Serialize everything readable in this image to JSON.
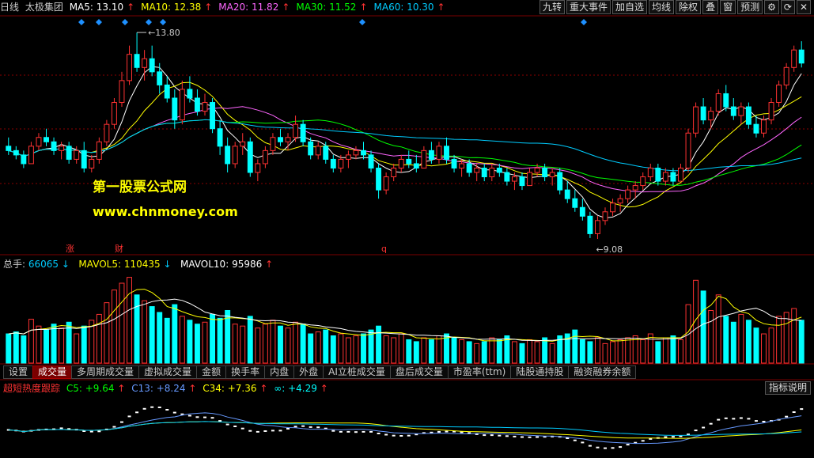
{
  "header": {
    "period": "日线",
    "stock_name": "太极集团",
    "ma": [
      {
        "label": "MA5: 13.10",
        "color": "#ffffff",
        "arrow": "up"
      },
      {
        "label": "MA10: 12.38",
        "color": "#ffff00",
        "arrow": "up"
      },
      {
        "label": "MA20: 11.82",
        "color": "#ff66ff",
        "arrow": "up"
      },
      {
        "label": "MA30: 11.52",
        "color": "#00ff00",
        "arrow": "up"
      },
      {
        "label": "MA60: 10.30",
        "color": "#00ccff",
        "arrow": "up"
      }
    ]
  },
  "toolbar": [
    "九转",
    "重大事件",
    "加自选",
    "均线",
    "除权",
    "叠",
    "窗",
    "预测"
  ],
  "price_markers": {
    "high": "13.80",
    "low": "9.08"
  },
  "watermark": {
    "line1": "第一股票公式网",
    "line2": "www.chnmoney.com"
  },
  "event_labels": [
    {
      "text": "涨"
    },
    {
      "text": "财"
    },
    {
      "text": "q"
    }
  ],
  "volume": {
    "total_label": "总手:",
    "total_value": "66065",
    "total_arrow": "down",
    "mavol5_label": "MAVOL5:",
    "mavol5_value": "110435",
    "mavol5_arrow": "down",
    "mavol10_label": "MAVOL10:",
    "mavol10_value": "95986",
    "mavol10_arrow": "up"
  },
  "tabs": [
    "设置",
    "成交量",
    "多周期成交量",
    "虚拟成交量",
    "金额",
    "换手率",
    "内盘",
    "外盘",
    "AI立桩成交量",
    "盘后成交量",
    "市盈率(ttm)",
    "陆股通持股",
    "融资融券余额"
  ],
  "active_tab": "成交量",
  "indicator": {
    "name": "超短热度跟踪",
    "c5": "C5: +9.64",
    "c13": "C13: +8.24",
    "c34": "C34: +7.36",
    "inf": "∞: +4.29",
    "help": "指标说明"
  },
  "colors": {
    "up": "#ff3232",
    "down": "#00ffff",
    "ma5": "#ffffff",
    "ma10": "#ffff00",
    "ma20": "#ff66ff",
    "ma30": "#00ff00",
    "ma60": "#00ccff",
    "grid": "#8b0000"
  },
  "chart_data": {
    "type": "candlestick",
    "price_high_label": 13.8,
    "price_low_label": 9.08,
    "candles": [
      [
        11.2,
        11.4,
        11.0,
        11.1
      ],
      [
        11.1,
        11.2,
        10.9,
        11.0
      ],
      [
        11.0,
        11.1,
        10.7,
        10.8
      ],
      [
        10.8,
        11.3,
        10.8,
        11.2
      ],
      [
        11.2,
        11.5,
        11.1,
        11.4
      ],
      [
        11.4,
        11.6,
        11.2,
        11.3
      ],
      [
        11.3,
        11.4,
        11.0,
        11.1
      ],
      [
        11.1,
        11.3,
        10.9,
        11.2
      ],
      [
        11.2,
        11.3,
        10.8,
        10.9
      ],
      [
        10.9,
        11.2,
        10.8,
        11.1
      ],
      [
        11.1,
        11.3,
        10.6,
        10.7
      ],
      [
        10.7,
        11.0,
        10.6,
        10.9
      ],
      [
        10.9,
        11.4,
        10.8,
        11.3
      ],
      [
        11.3,
        11.8,
        11.2,
        11.7
      ],
      [
        11.7,
        12.3,
        11.6,
        12.2
      ],
      [
        12.2,
        12.9,
        12.1,
        12.7
      ],
      [
        12.7,
        13.5,
        12.6,
        13.3
      ],
      [
        13.3,
        13.8,
        12.9,
        13.0
      ],
      [
        13.0,
        13.4,
        12.7,
        13.2
      ],
      [
        13.2,
        13.5,
        12.8,
        12.9
      ],
      [
        12.9,
        13.1,
        12.4,
        12.6
      ],
      [
        12.6,
        12.8,
        12.2,
        12.3
      ],
      [
        12.3,
        12.5,
        11.6,
        11.8
      ],
      [
        11.8,
        12.7,
        11.7,
        12.5
      ],
      [
        12.5,
        12.8,
        12.2,
        12.3
      ],
      [
        12.3,
        12.5,
        11.9,
        12.0
      ],
      [
        12.0,
        12.4,
        11.9,
        12.2
      ],
      [
        12.2,
        12.3,
        11.5,
        11.6
      ],
      [
        11.6,
        11.8,
        11.0,
        11.2
      ],
      [
        11.2,
        11.4,
        10.6,
        10.8
      ],
      [
        10.8,
        11.3,
        10.7,
        11.2
      ],
      [
        11.2,
        11.5,
        11.0,
        11.3
      ],
      [
        11.3,
        11.4,
        10.5,
        10.6
      ],
      [
        10.6,
        10.9,
        10.4,
        10.8
      ],
      [
        10.8,
        11.2,
        10.7,
        11.1
      ],
      [
        11.1,
        11.5,
        11.0,
        11.4
      ],
      [
        11.4,
        11.6,
        11.2,
        11.3
      ],
      [
        11.3,
        11.5,
        11.1,
        11.4
      ],
      [
        11.4,
        11.9,
        11.3,
        11.7
      ],
      [
        11.7,
        11.8,
        11.2,
        11.3
      ],
      [
        11.3,
        11.4,
        10.9,
        11.0
      ],
      [
        11.0,
        11.3,
        10.9,
        11.2
      ],
      [
        11.2,
        11.3,
        10.8,
        10.9
      ],
      [
        10.9,
        11.0,
        10.6,
        10.7
      ],
      [
        10.7,
        11.0,
        10.6,
        10.9
      ],
      [
        10.9,
        11.1,
        10.7,
        11.0
      ],
      [
        11.0,
        11.2,
        10.9,
        11.1
      ],
      [
        11.1,
        11.3,
        10.9,
        11.0
      ],
      [
        11.0,
        11.1,
        10.6,
        10.7
      ],
      [
        10.7,
        10.8,
        10.0,
        10.2
      ],
      [
        10.2,
        10.6,
        10.1,
        10.5
      ],
      [
        10.5,
        10.8,
        10.4,
        10.7
      ],
      [
        10.7,
        11.0,
        10.6,
        10.9
      ],
      [
        10.9,
        11.1,
        10.7,
        10.8
      ],
      [
        10.8,
        11.0,
        10.6,
        10.7
      ],
      [
        10.7,
        11.2,
        10.7,
        11.1
      ],
      [
        11.1,
        11.3,
        10.8,
        10.9
      ],
      [
        10.9,
        11.3,
        10.8,
        11.2
      ],
      [
        11.2,
        11.4,
        10.8,
        10.9
      ],
      [
        10.9,
        11.0,
        10.6,
        10.7
      ],
      [
        10.7,
        10.9,
        10.5,
        10.8
      ],
      [
        10.8,
        10.9,
        10.5,
        10.6
      ],
      [
        10.6,
        10.8,
        10.4,
        10.7
      ],
      [
        10.7,
        10.8,
        10.4,
        10.5
      ],
      [
        10.5,
        10.8,
        10.4,
        10.7
      ],
      [
        10.7,
        10.8,
        10.5,
        10.6
      ],
      [
        10.6,
        10.7,
        10.3,
        10.4
      ],
      [
        10.4,
        10.6,
        10.2,
        10.5
      ],
      [
        10.5,
        10.6,
        10.2,
        10.3
      ],
      [
        10.3,
        10.7,
        10.3,
        10.6
      ],
      [
        10.6,
        10.8,
        10.5,
        10.7
      ],
      [
        10.7,
        10.8,
        10.4,
        10.5
      ],
      [
        10.5,
        10.7,
        10.3,
        10.6
      ],
      [
        10.6,
        10.7,
        10.1,
        10.2
      ],
      [
        10.2,
        10.4,
        9.9,
        10.0
      ],
      [
        10.0,
        10.2,
        9.7,
        9.8
      ],
      [
        9.8,
        10.0,
        9.5,
        9.6
      ],
      [
        9.6,
        9.7,
        9.1,
        9.2
      ],
      [
        9.2,
        9.6,
        9.08,
        9.5
      ],
      [
        9.5,
        9.8,
        9.4,
        9.7
      ],
      [
        9.7,
        10.0,
        9.6,
        9.9
      ],
      [
        9.9,
        10.1,
        9.7,
        10.0
      ],
      [
        10.0,
        10.3,
        9.9,
        10.2
      ],
      [
        10.2,
        10.4,
        10.0,
        10.3
      ],
      [
        10.3,
        10.6,
        10.2,
        10.5
      ],
      [
        10.5,
        10.8,
        10.4,
        10.7
      ],
      [
        10.7,
        10.8,
        10.3,
        10.4
      ],
      [
        10.4,
        10.7,
        10.3,
        10.6
      ],
      [
        10.6,
        10.7,
        10.3,
        10.4
      ],
      [
        10.4,
        10.8,
        10.4,
        10.7
      ],
      [
        10.7,
        11.6,
        10.6,
        11.5
      ],
      [
        11.5,
        12.2,
        11.4,
        12.1
      ],
      [
        12.1,
        12.3,
        11.7,
        11.8
      ],
      [
        11.8,
        12.1,
        11.6,
        12.0
      ],
      [
        12.0,
        12.5,
        11.9,
        12.4
      ],
      [
        12.4,
        12.6,
        12.0,
        12.1
      ],
      [
        12.1,
        12.3,
        11.8,
        11.9
      ],
      [
        11.9,
        12.2,
        11.7,
        12.1
      ],
      [
        12.1,
        12.2,
        11.6,
        11.7
      ],
      [
        11.7,
        11.9,
        11.4,
        11.5
      ],
      [
        11.5,
        11.9,
        11.4,
        11.8
      ],
      [
        11.8,
        12.3,
        11.7,
        12.2
      ],
      [
        12.2,
        12.7,
        12.1,
        12.6
      ],
      [
        12.6,
        13.1,
        12.5,
        13.0
      ],
      [
        13.0,
        13.5,
        12.9,
        13.4
      ],
      [
        13.4,
        13.6,
        13.0,
        13.1
      ]
    ],
    "volume": [
      30,
      32,
      28,
      45,
      38,
      34,
      40,
      36,
      42,
      30,
      38,
      44,
      50,
      62,
      75,
      82,
      88,
      70,
      64,
      58,
      52,
      46,
      60,
      48,
      44,
      40,
      42,
      50,
      46,
      54,
      40,
      38,
      48,
      36,
      40,
      44,
      38,
      36,
      42,
      40,
      30,
      32,
      34,
      28,
      30,
      26,
      28,
      30,
      34,
      38,
      28,
      26,
      30,
      24,
      22,
      26,
      24,
      28,
      30,
      26,
      24,
      22,
      20,
      22,
      26,
      24,
      28,
      22,
      20,
      24,
      22,
      26,
      20,
      28,
      30,
      34,
      24,
      22,
      26,
      20,
      22,
      24,
      26,
      28,
      24,
      30,
      22,
      26,
      28,
      24,
      60,
      85,
      74,
      54,
      70,
      48,
      42,
      50,
      44,
      36,
      30,
      36,
      48,
      52,
      56,
      44
    ]
  }
}
